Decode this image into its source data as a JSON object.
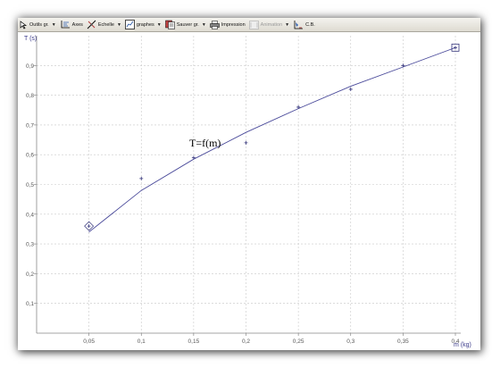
{
  "toolbar": {
    "items": [
      {
        "label": "Outils gr.",
        "icon": "cursor-icon",
        "dropdown": true
      },
      {
        "label": "Axes",
        "icon": "axes-icon",
        "dropdown": false
      },
      {
        "label": "Echelle",
        "icon": "scale-icon",
        "dropdown": true
      },
      {
        "label": "graphes",
        "icon": "graph-icon",
        "dropdown": true
      },
      {
        "label": "Sauver gr.",
        "icon": "save-icon",
        "dropdown": true
      },
      {
        "label": "Impression",
        "icon": "print-icon",
        "dropdown": false
      },
      {
        "label": "Animation",
        "icon": "animation-icon",
        "dropdown": true,
        "disabled": true
      },
      {
        "label": "C.B.",
        "icon": "clipboard-icon",
        "dropdown": false
      }
    ]
  },
  "chart_data": {
    "type": "scatter",
    "ylabel": "T (s)",
    "xlabel": "m (kg)",
    "annotation": "T=f(m)",
    "xlim": [
      0,
      0.4
    ],
    "ylim": [
      0,
      1.0
    ],
    "grid": true,
    "x_ticks": [
      "0,05",
      "0,1",
      "0,15",
      "0,2",
      "0,25",
      "0,3",
      "0,35",
      "0,4"
    ],
    "y_ticks": [
      "0,1",
      "0,2",
      "0,3",
      "0,4",
      "0,5",
      "0,6",
      "0,7",
      "0,8",
      "0,9"
    ],
    "points": [
      {
        "x": 0.05,
        "y": 0.36
      },
      {
        "x": 0.1,
        "y": 0.52
      },
      {
        "x": 0.15,
        "y": 0.59
      },
      {
        "x": 0.2,
        "y": 0.64
      },
      {
        "x": 0.25,
        "y": 0.76
      },
      {
        "x": 0.3,
        "y": 0.82
      },
      {
        "x": 0.35,
        "y": 0.9
      },
      {
        "x": 0.4,
        "y": 0.96
      }
    ],
    "curve": [
      {
        "x": 0.05,
        "y": 0.34
      },
      {
        "x": 0.1,
        "y": 0.48
      },
      {
        "x": 0.15,
        "y": 0.585
      },
      {
        "x": 0.2,
        "y": 0.675
      },
      {
        "x": 0.25,
        "y": 0.755
      },
      {
        "x": 0.3,
        "y": 0.83
      },
      {
        "x": 0.35,
        "y": 0.895
      },
      {
        "x": 0.4,
        "y": 0.96
      }
    ],
    "line_color": "#4a4a9a",
    "marker_color": "#33337a",
    "grid_color": "#c8c8c8"
  }
}
